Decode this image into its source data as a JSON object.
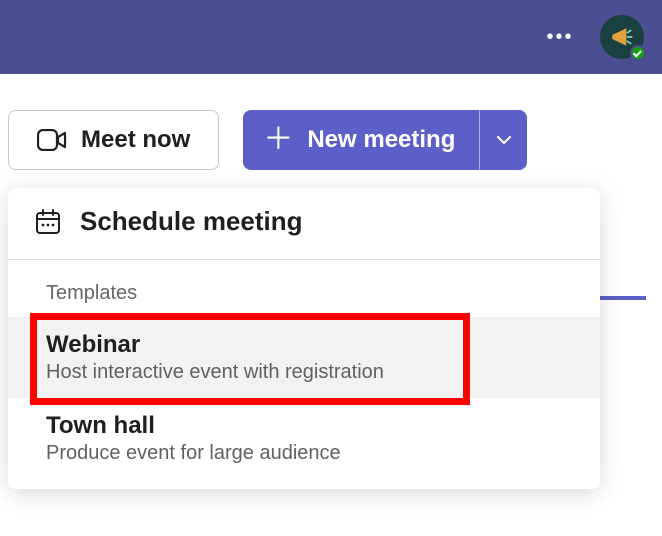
{
  "titlebar": {
    "avatar_status": "available"
  },
  "actions": {
    "meet_now": "Meet now",
    "new_meeting": "New meeting"
  },
  "dropdown": {
    "schedule": "Schedule meeting",
    "templates_heading": "Templates",
    "templates": [
      {
        "title": "Webinar",
        "desc": "Host interactive event with registration"
      },
      {
        "title": "Town hall",
        "desc": "Produce event for large audience"
      }
    ]
  }
}
